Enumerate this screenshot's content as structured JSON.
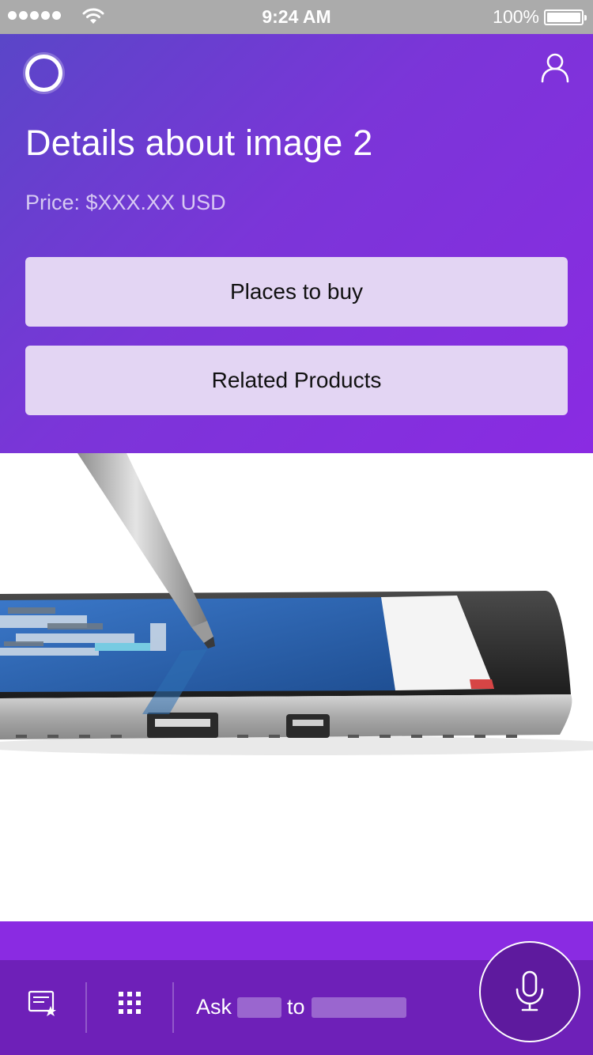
{
  "status_bar": {
    "time": "9:24 AM",
    "battery_percent": "100%",
    "signal_dots": 5,
    "icons": [
      "signal-dots-icon",
      "wifi-icon",
      "battery-icon"
    ]
  },
  "header": {
    "title": "Details about image 2",
    "price": "Price: $XXX.XX USD",
    "icons": [
      "assistant-ring-icon",
      "profile-icon"
    ],
    "buttons": {
      "places_to_buy": "Places to buy",
      "related_products": "Related Products"
    }
  },
  "product_image": {
    "subject": "tablet-with-stylus"
  },
  "bottom_bar": {
    "ask_prefix": "Ask",
    "ask_middle": "to",
    "icons": [
      "notebook-star-icon",
      "apps-grid-icon",
      "microphone-icon"
    ]
  },
  "colors": {
    "status_bar": "#ababab",
    "header_start": "#5a46c8",
    "header_end": "#8a2be2",
    "button_bg": "#e3d5f3",
    "bottom_bar": "#6e20b8",
    "mic_button": "#5e1a9e"
  }
}
